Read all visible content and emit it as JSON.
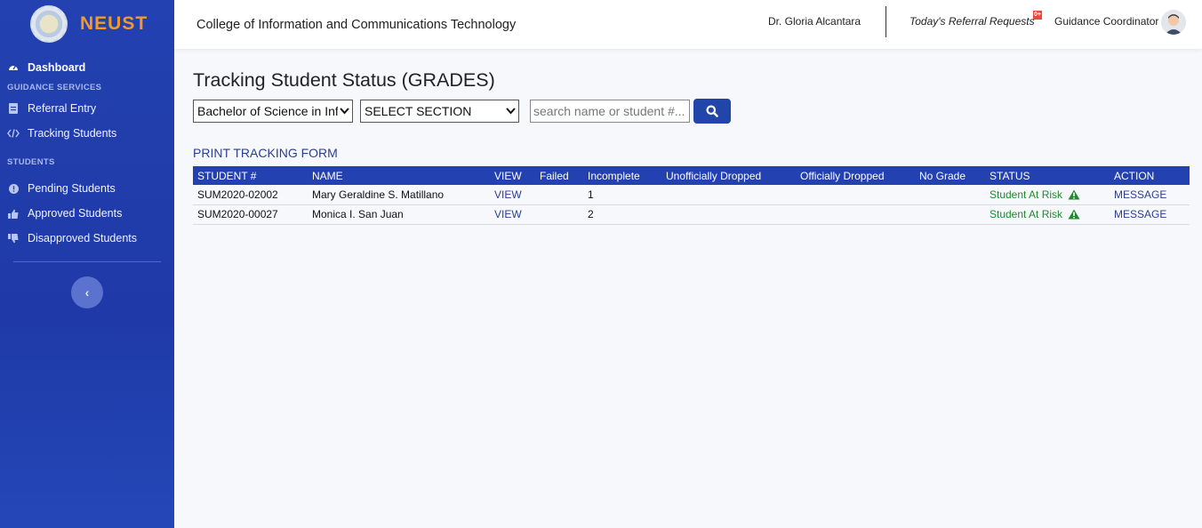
{
  "brand": {
    "name": "NEUST"
  },
  "sidebar": {
    "dashboard": "Dashboard",
    "section_guidance": "GUIDANCE SERVICES",
    "referral_entry": "Referral Entry",
    "tracking_students": "Tracking Students",
    "section_students": "STUDENTS",
    "pending_students": "Pending Students",
    "approved_students": "Approved Students",
    "disapproved_students": "Disapproved Students",
    "collapse_icon": "‹"
  },
  "topbar": {
    "college": "College of Information and Communications Technology",
    "user_name": "Dr. Gloria Alcantara",
    "referral_label": "Today's Referral Requests",
    "referral_badge": "0+",
    "role": "Guidance Coordinator"
  },
  "main": {
    "title": "Tracking Student Status (GRADES)",
    "program_select": "Bachelor of Science in Info",
    "section_select": "SELECT SECTION",
    "search_placeholder": "search name or student #...",
    "print_link": "PRINT TRACKING FORM"
  },
  "table": {
    "headers": [
      "STUDENT #",
      "NAME",
      "VIEW",
      "Failed",
      "Incomplete",
      "Unofficially Dropped",
      "Officially Dropped",
      "No Grade",
      "STATUS",
      "ACTION"
    ],
    "rows": [
      {
        "student_no": "SUM2020-02002",
        "name": "Mary Geraldine S. Matillano",
        "view": "VIEW",
        "failed": "",
        "incomplete": "1",
        "unofficially_dropped": "",
        "officially_dropped": "",
        "no_grade": "",
        "status": "Student At Risk",
        "action": "MESSAGE"
      },
      {
        "student_no": "SUM2020-00027",
        "name": "Monica I. San Juan",
        "view": "VIEW",
        "failed": "",
        "incomplete": "2",
        "unofficially_dropped": "",
        "officially_dropped": "",
        "no_grade": "",
        "status": "Student At Risk",
        "action": "MESSAGE"
      }
    ]
  },
  "colors": {
    "sidebar": "#2341b0",
    "brand_text": "#f3982d",
    "table_header": "#2341b0",
    "status_risk": "#1f8a2e",
    "link": "#2b3f8f",
    "badge": "#e74a3b"
  }
}
